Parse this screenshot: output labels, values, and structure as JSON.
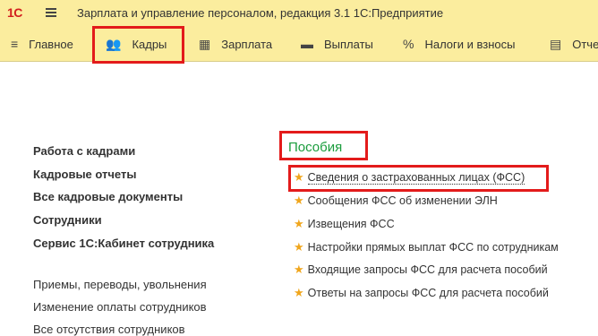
{
  "titlebar": {
    "logo": "1С",
    "title": "Зарплата и управление персоналом, редакция 3.1 1С:Предприятие"
  },
  "nav": {
    "items": [
      {
        "label": "Главное",
        "icon": "≡"
      },
      {
        "label": "Кадры",
        "icon": "👥"
      },
      {
        "label": "Зарплата",
        "icon": "▦"
      },
      {
        "label": "Выплаты",
        "icon": "▬"
      },
      {
        "label": "Налоги и взносы",
        "icon": "%"
      },
      {
        "label": "Отче",
        "icon": "▤"
      }
    ]
  },
  "left_menu": {
    "bold": [
      "Работа с кадрами",
      "Кадровые отчеты",
      "Все кадровые документы",
      "Сотрудники",
      "Сервис 1С:Кабинет сотрудника"
    ],
    "plain": [
      "Приемы, переводы, увольнения",
      "Изменение оплаты сотрудников",
      "Все отсутствия сотрудников"
    ]
  },
  "benefits": {
    "title": "Пособия",
    "links": [
      "Сведения о застрахованных лицах (ФСС)",
      "Сообщения ФСС об изменении ЭЛН",
      "Извещения ФСС",
      "Настройки прямых выплат ФСС по сотрудникам",
      "Входящие запросы ФСС для расчета пособий",
      "Ответы на запросы ФСС для расчета пособий"
    ]
  }
}
